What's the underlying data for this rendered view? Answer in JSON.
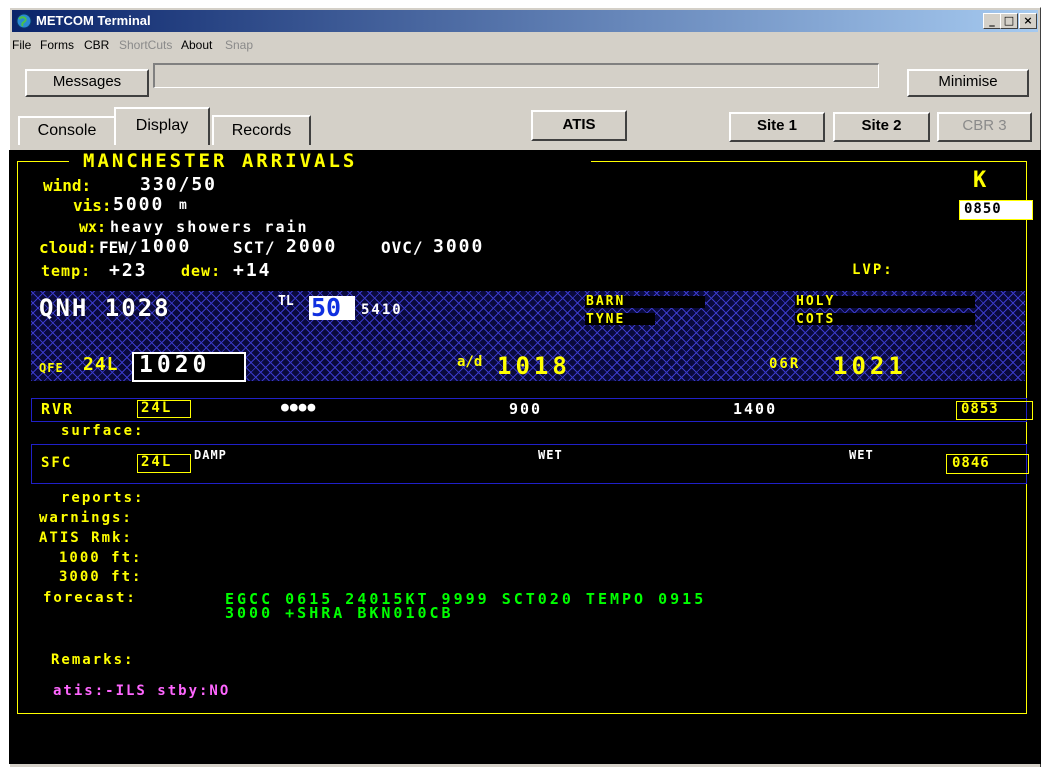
{
  "window": {
    "title": "METCOM Terminal",
    "min": "_",
    "max": "□",
    "close": "×"
  },
  "menu": [
    "File",
    "Forms",
    "CBR",
    "ShortCuts",
    "About",
    "Snap"
  ],
  "toolbar": {
    "messages": "Messages",
    "minimise": "Minimise"
  },
  "tabs": [
    "Console",
    "Display",
    "Records"
  ],
  "buttons": {
    "atis": "ATIS",
    "site1": "Site 1",
    "site2": "Site 2",
    "cbr3": "CBR 3"
  },
  "display": {
    "header": "MANCHESTER ARRIVALS",
    "wind_label": "wind:",
    "wind": "330/50",
    "vis_label": "vis:",
    "vis": "5000",
    "vis_unit": "m",
    "wx_label": "wx:",
    "wx": "heavy showers rain",
    "cloud_label": "cloud:",
    "cloud_few": "FEW/",
    "cloud_few_h": "1000",
    "cloud_sct": "SCT/",
    "cloud_sct_h": "2000",
    "cloud_ovc": "OVC/",
    "cloud_ovc_h": "3000",
    "temp_label": "temp:",
    "temp": "+23",
    "dew_label": "dew:",
    "dew": "+14",
    "lvp_label": "LVP:",
    "code_letter": "K",
    "time1": "0850",
    "qnh": "QNH 1028",
    "tl_label": "TL",
    "tl": "50",
    "qnh_code": "5410",
    "barn": "BARN",
    "tyne": "TYNE",
    "holy": "HOLY",
    "cots": "COTS",
    "qfe_label": "QFE",
    "qfe_rwy": "24L",
    "qfe": "1020",
    "ad_label": "a/d",
    "ad": "1018",
    "rwy2": "06R",
    "rwy2_val": "1021",
    "rvr_label": "RVR",
    "rvr_rwy": "24L",
    "rvr1": "●●●●",
    "rvr2": "900",
    "rvr3": "1400",
    "time2": "0853",
    "surface_label": "surface:",
    "sfc_label": "SFC",
    "sfc_rwy": "24L",
    "sfc1": "DAMP",
    "sfc2": "WET",
    "sfc3": "WET",
    "time3": "0846",
    "reports_label": "reports:",
    "warnings_label": "warnings:",
    "atis_rmk_label": "ATIS Rmk:",
    "ft1000_label": "1000 ft:",
    "ft3000_label": "3000 ft:",
    "forecast_label": "forecast:",
    "forecast_line1": "EGCC 0615 24015KT 9999 SCT020 TEMPO 0915",
    "forecast_line2": "3000 +SHRA BKN010CB",
    "remarks_label": "Remarks:",
    "atis_remark": "atis:-ILS stby:NO"
  },
  "colors": {
    "yellow": "#ffff00",
    "green": "#00ff00",
    "magenta": "#ff66ff",
    "blue": "#2020c8"
  }
}
